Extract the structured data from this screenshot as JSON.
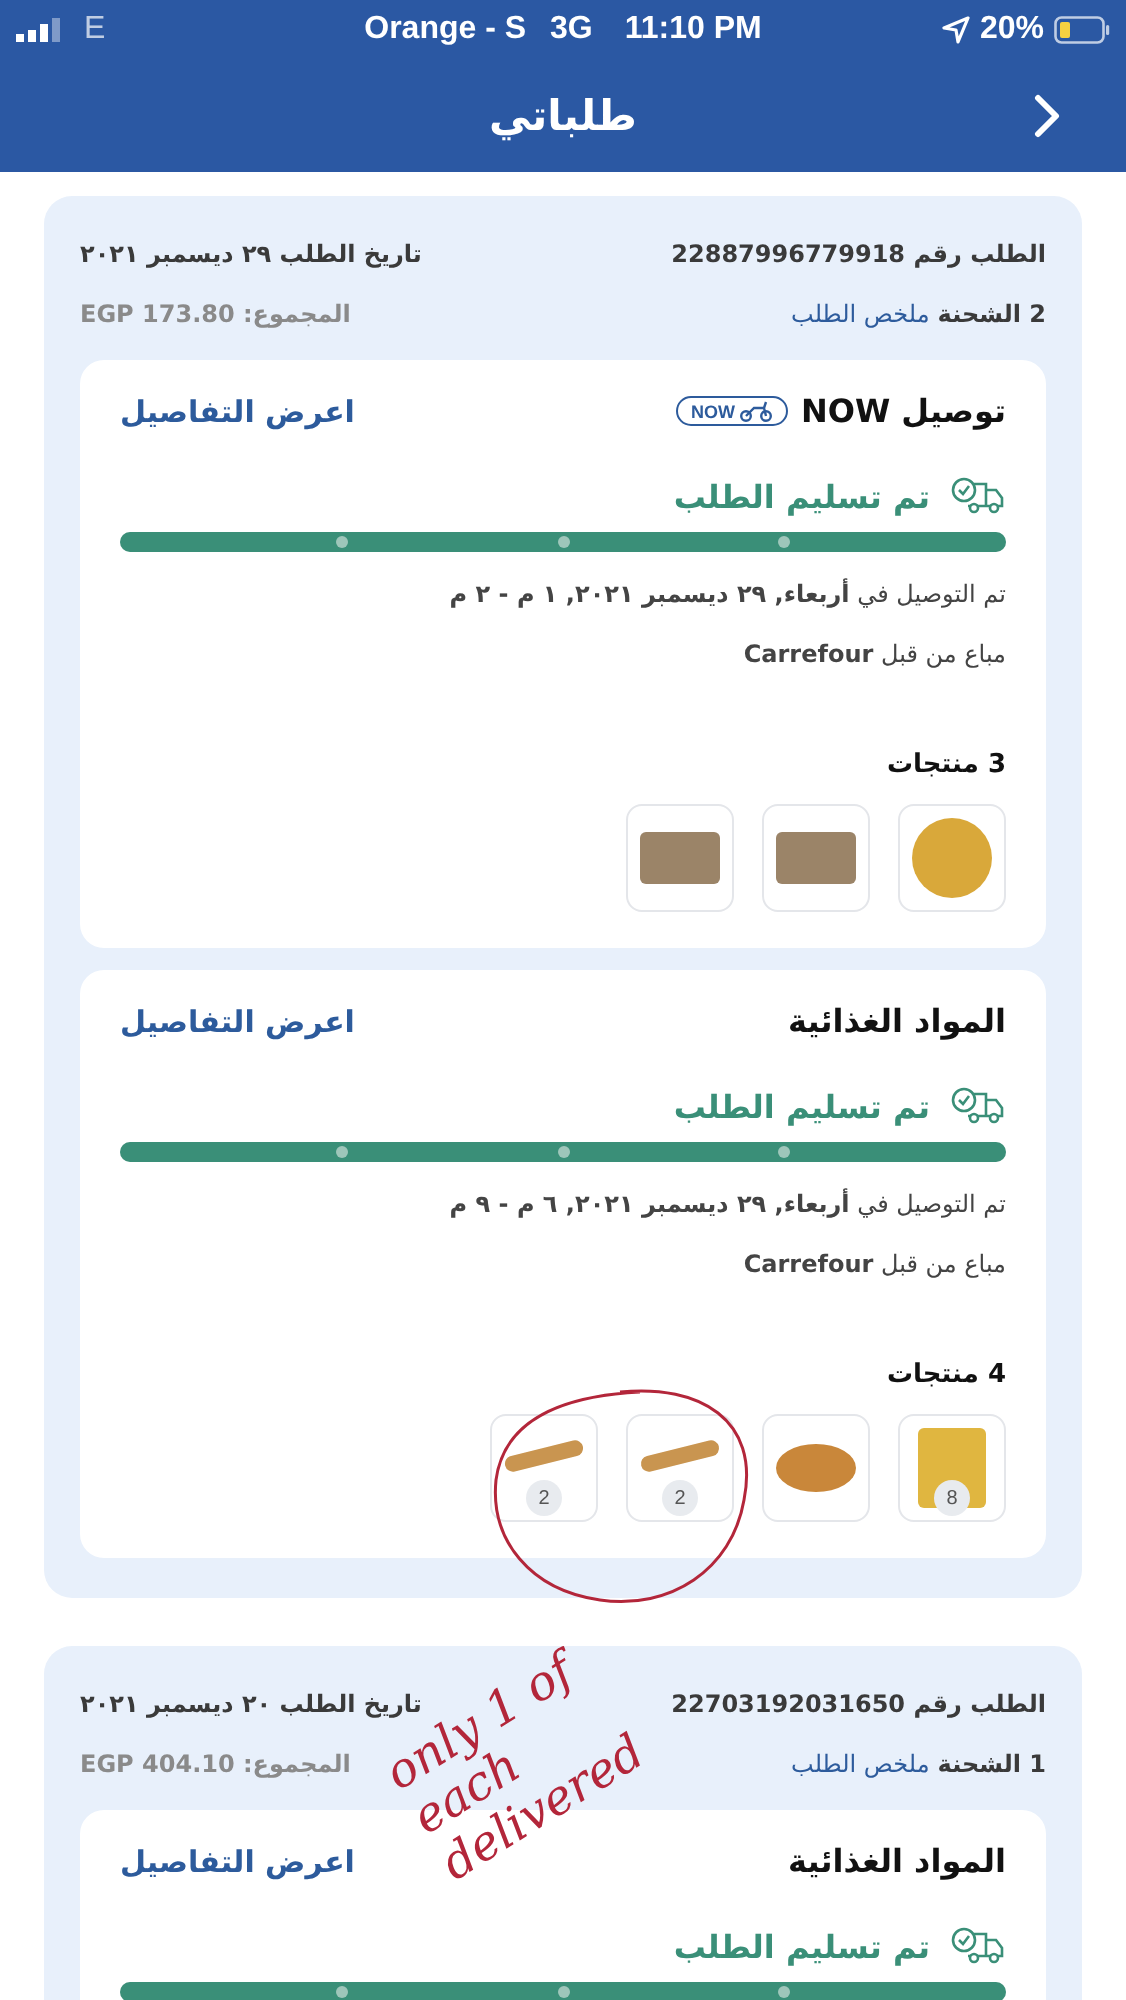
{
  "status_bar": {
    "network": "E",
    "carrier": "Orange - S",
    "network_type": "3G",
    "time": "11:10 PM",
    "battery": "20%"
  },
  "header": {
    "title": "طلباتي"
  },
  "orders": [
    {
      "order_number": "الطلب رقم 22887996779918",
      "order_date": "تاريخ الطلب ٢٩ ديسمبر ٢٠٢١",
      "shipment_count": "2 الشحنة",
      "summary_link": "ملخص الطلب",
      "total": "المجموع: EGP 173.80",
      "shipments": [
        {
          "title": "توصيل NOW",
          "badge": "NOW",
          "details_link": "اعرض التفاصيل",
          "status": "تم تسليم الطلب",
          "level": 1,
          "delivery": "تم التوصيل في **أربعاء, ٢٩ ديسمبر ٢٠٢١, ١ م - ٢ م**",
          "seller": "مباع من قبل **Carrefour**",
          "products_count": "3 منتجات",
          "products": [
            {
              "kind": "tin"
            },
            {
              "kind": "tray"
            },
            {
              "kind": "tray"
            }
          ]
        },
        {
          "title": "المواد الغذائية",
          "details_link": "اعرض التفاصيل",
          "status": "تم تسليم الطلب",
          "level": 1,
          "delivery": "تم التوصيل في **أربعاء, ٢٩ ديسمبر ٢٠٢١, ٦ م - ٩ م**",
          "seller": "مباع من قبل **Carrefour**",
          "products_count": "4 منتجات",
          "products": [
            {
              "kind": "sticks",
              "quantity": "8"
            },
            {
              "kind": "bun"
            },
            {
              "kind": "baguette",
              "quantity": "2"
            },
            {
              "kind": "baguette",
              "quantity": "2"
            }
          ]
        }
      ]
    },
    {
      "order_number": "الطلب رقم 22703192031650",
      "order_date": "تاريخ الطلب ٢٠ ديسمبر ٢٠٢١",
      "shipment_count": "1 الشحنة",
      "summary_link": "ملخص الطلب",
      "total": "المجموع: EGP 404.10",
      "shipments": [
        {
          "title": "المواد الغذائية",
          "details_link": "اعرض التفاصيل",
          "status": "تم تسليم الطلب",
          "level": 1
        }
      ]
    }
  ],
  "annotation": {
    "text": "only 1 of each delivered"
  }
}
